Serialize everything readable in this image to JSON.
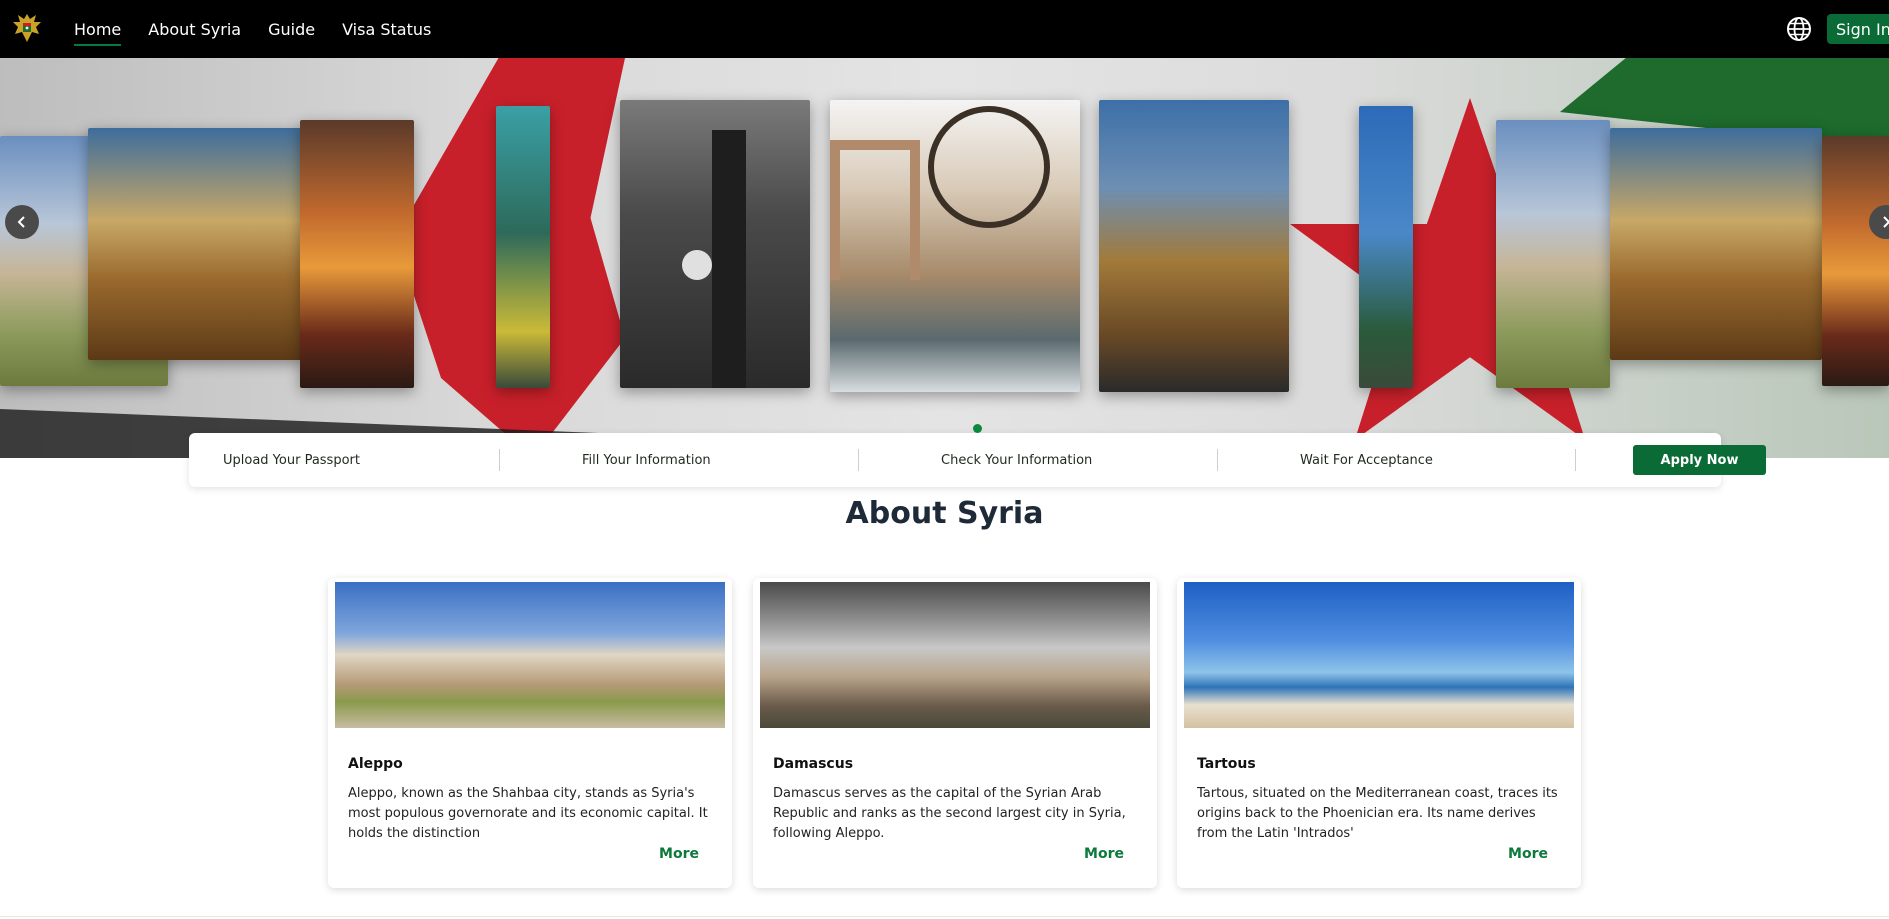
{
  "nav": {
    "links": [
      "Home",
      "About Syria",
      "Guide",
      "Visa Status"
    ],
    "active": "Home",
    "signin_label": "Sign In"
  },
  "hero": {
    "slides": [
      "Palmyra theater",
      "Palmyra citadel",
      "Monument",
      "Statue",
      "Clock tower",
      "Hama water wheel",
      "Umayyad mosque",
      "Clock tower",
      "Palmyra theater",
      "Palmyra citadel",
      "Monument"
    ],
    "active_slide": 5
  },
  "steps": {
    "items": [
      "Upload Your Passport",
      "Fill Your Information",
      "Check Your Information",
      "Wait For Acceptance"
    ],
    "apply_label": "Apply Now"
  },
  "about": {
    "title": "About Syria",
    "cards": [
      {
        "title": "Aleppo",
        "desc": "Aleppo, known as the Shahbaa city, stands as Syria's most populous governorate and its economic capital. It holds the distinction",
        "more": "More"
      },
      {
        "title": "Damascus",
        "desc": "Damascus serves as the capital of the Syrian Arab Republic and ranks as the second largest city in Syria, following Aleppo.",
        "more": "More"
      },
      {
        "title": "Tartous",
        "desc": "Tartous, situated on the Mediterranean coast, traces its origins back to the Phoenician era. Its name derives from the Latin 'Intrados'",
        "more": "More"
      }
    ]
  },
  "colors": {
    "accent": "#0b6b36",
    "nav_bg": "#000000",
    "flag_red": "#c8202a"
  }
}
